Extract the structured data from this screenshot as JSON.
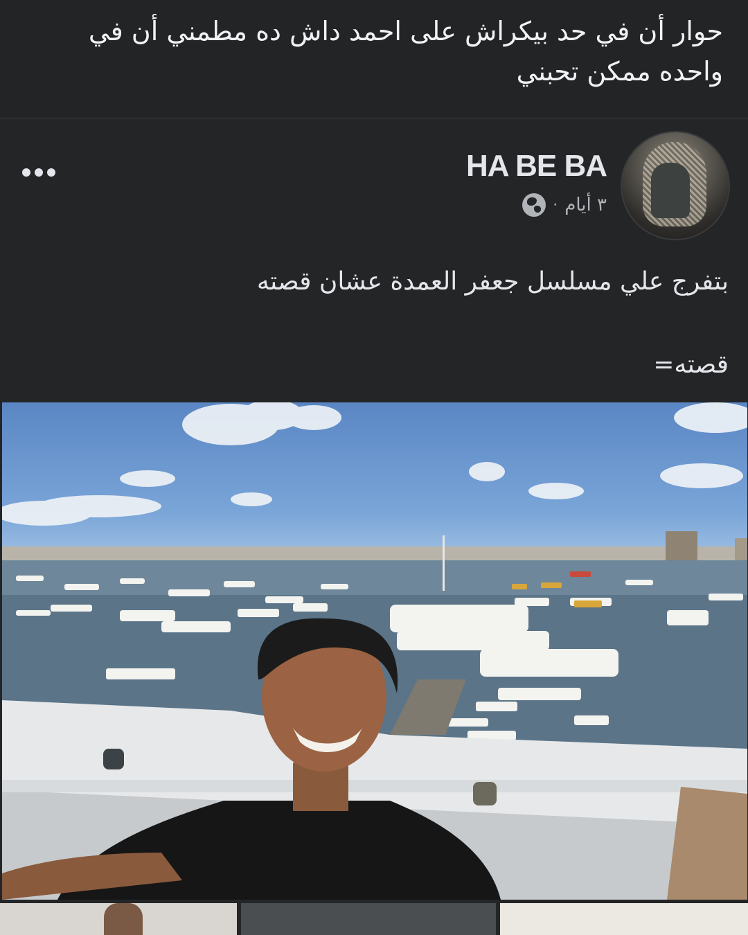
{
  "caption": "حوار أن في حد بيكراش على احمد داش ده مطمني أن في واحده ممكن تحبني",
  "post": {
    "author": "HA BE BA",
    "time": "٣ أيام",
    "separator": "·",
    "privacy_icon": "globe-icon",
    "more_icon": "more-options-icon",
    "line1": "بتفرج علي مسلسل جعفر العمدة عشان قصته",
    "line2": "قصته="
  },
  "colors": {
    "background": "#242526",
    "text": "#e4e6eb",
    "secondary_text": "#b0b3b8"
  }
}
